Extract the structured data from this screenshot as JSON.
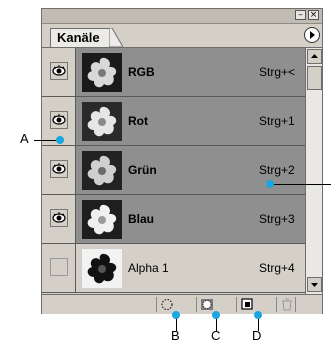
{
  "panel": {
    "tab_label": "Kanäle",
    "window_controls": [
      "minimize",
      "close"
    ]
  },
  "channels": [
    {
      "name": "RGB",
      "shortcut": "Strg+<",
      "visible": true
    },
    {
      "name": "Rot",
      "shortcut": "Strg+1",
      "visible": true
    },
    {
      "name": "Grün",
      "shortcut": "Strg+2",
      "visible": true
    },
    {
      "name": "Blau",
      "shortcut": "Strg+3",
      "visible": true
    },
    {
      "name": "Alpha 1",
      "shortcut": "Strg+4",
      "visible": false
    }
  ],
  "callouts": {
    "a": "A",
    "b": "B",
    "c": "C",
    "d": "D"
  },
  "icons": {
    "eye": "eye-icon",
    "menu": "panel-menu-icon",
    "load_selection": "dotted-circle-icon",
    "save_selection": "selection-mask-icon",
    "new_channel": "new-channel-icon",
    "delete": "trash-icon"
  },
  "colors": {
    "callout_accent": "#1aa6e2",
    "selected_row": "#8f8f8f",
    "panel_bg": "#d4d0c8"
  }
}
